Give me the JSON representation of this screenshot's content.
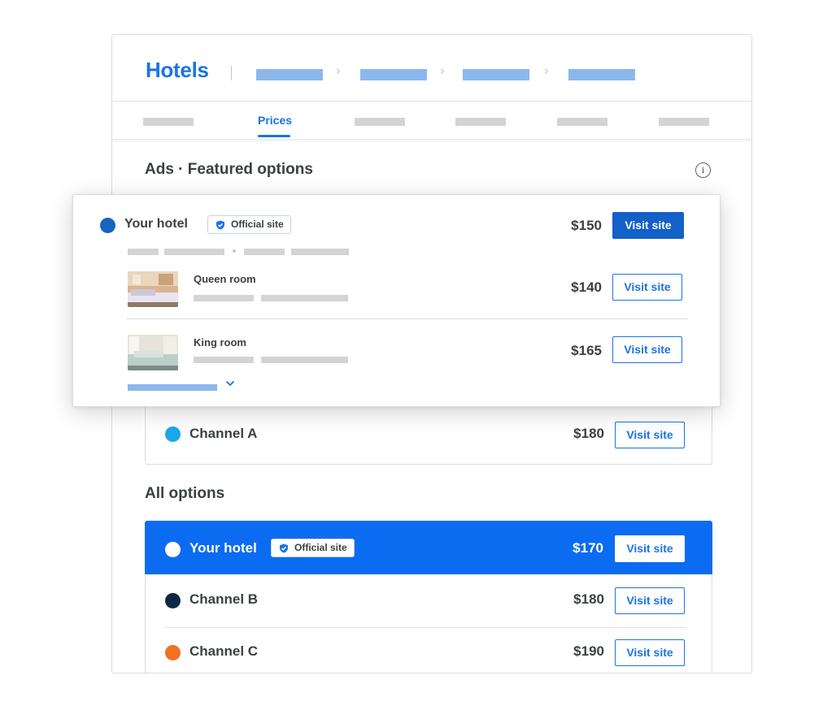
{
  "header": {
    "title": "Hotels"
  },
  "tabs": {
    "active_label": "Prices"
  },
  "featured": {
    "title": "Ads · Featured options",
    "card": {
      "hotel_name": "Your hotel",
      "badge": "Official site",
      "price": "$150",
      "button": "Visit site",
      "dot_color": "#1565c0",
      "rooms": [
        {
          "name": "Queen room",
          "price": "$140",
          "button": "Visit site"
        },
        {
          "name": "King room",
          "price": "$165",
          "button": "Visit site"
        }
      ]
    },
    "channel_a": {
      "name": "Channel A",
      "price": "$180",
      "button": "Visit site",
      "dot_color": "#1aa7ec"
    }
  },
  "all_options": {
    "title": "All options",
    "rows": [
      {
        "name": "Your hotel",
        "badge": "Official site",
        "price": "$170",
        "button": "Visit site",
        "dot_color": "#ffffff",
        "highlighted": true
      },
      {
        "name": "Channel B",
        "price": "$180",
        "button": "Visit site",
        "dot_color": "#0d2747"
      },
      {
        "name": "Channel C",
        "price": "$190",
        "button": "Visit site",
        "dot_color": "#f36f21"
      }
    ]
  },
  "colors": {
    "accent": "#1a73e8",
    "highlight": "#0b6cf2"
  }
}
